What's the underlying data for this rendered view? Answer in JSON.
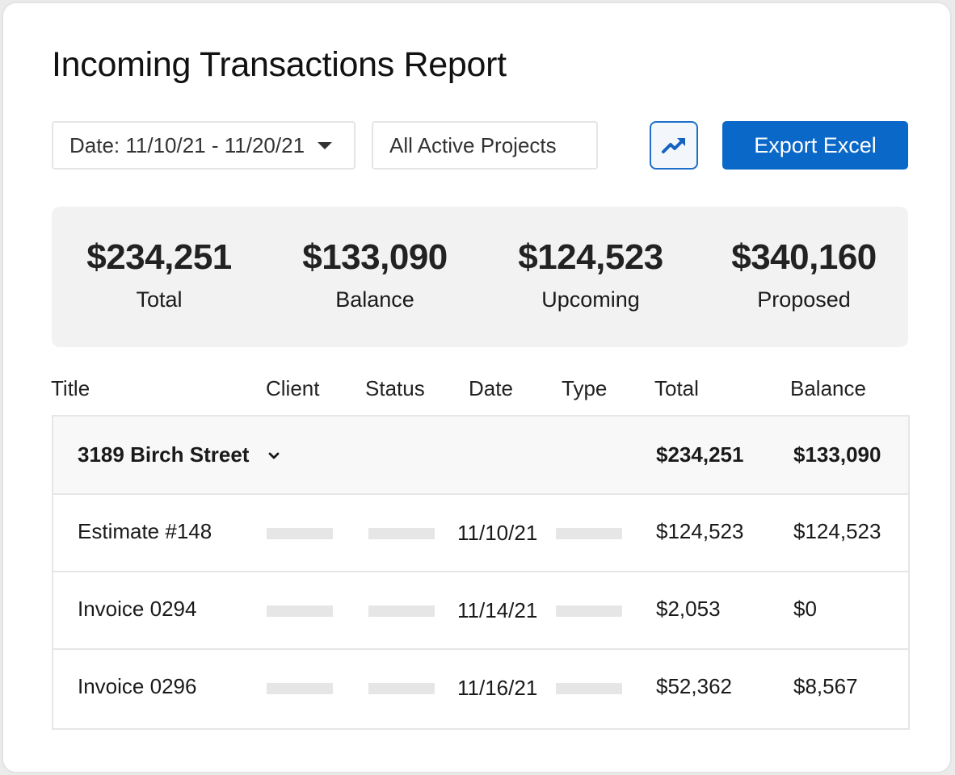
{
  "header": {
    "title": "Incoming Transactions Report"
  },
  "toolbar": {
    "date_filter": "Date: 11/10/21 - 11/20/21",
    "project_filter": "All Active Projects",
    "chart_icon": "trending-up-icon",
    "export_label": "Export Excel"
  },
  "colors": {
    "accent": "#0a68c9",
    "summary_bg": "#f2f2f2",
    "placeholder": "#e6e6e6"
  },
  "summary": [
    {
      "value": "$234,251",
      "label": "Total"
    },
    {
      "value": "$133,090",
      "label": "Balance"
    },
    {
      "value": "$124,523",
      "label": "Upcoming"
    },
    {
      "value": "$340,160",
      "label": "Proposed"
    }
  ],
  "table": {
    "columns": [
      "Title",
      "Client",
      "Status",
      "Date",
      "Type",
      "Total",
      "Balance"
    ],
    "group": {
      "title": "3189 Birch Street",
      "total": "$234,251",
      "balance": "$133,090"
    },
    "rows": [
      {
        "title": "Estimate #148",
        "date": "11/10/21",
        "total": "$124,523",
        "balance": "$124,523"
      },
      {
        "title": "Invoice 0294",
        "date": "11/14/21",
        "total": "$2,053",
        "balance": "$0"
      },
      {
        "title": "Invoice 0296",
        "date": "11/16/21",
        "total": "$52,362",
        "balance": "$8,567"
      }
    ]
  }
}
